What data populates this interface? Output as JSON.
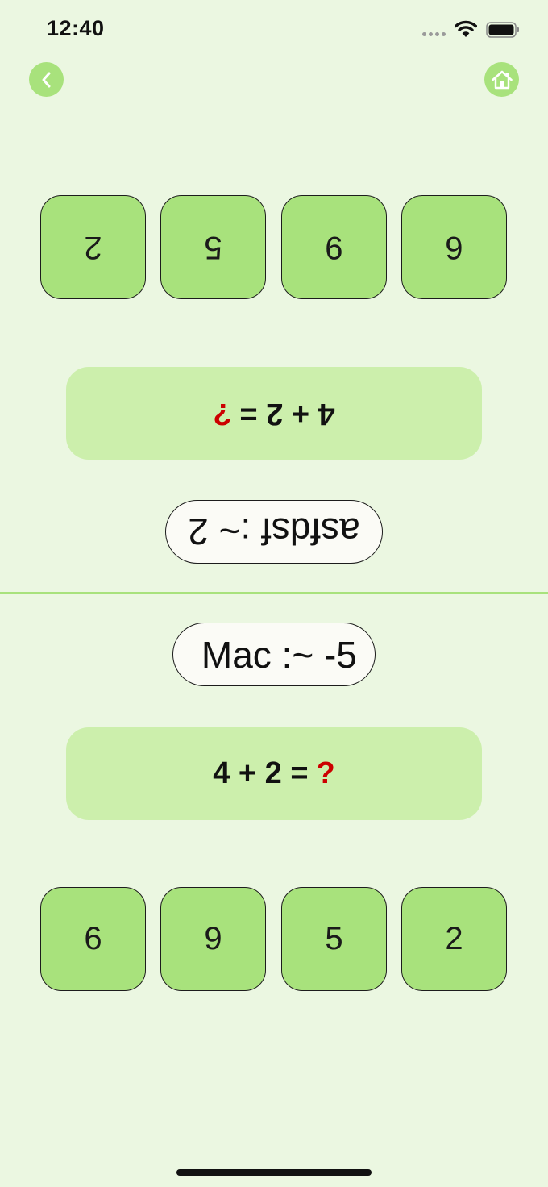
{
  "status_bar": {
    "time": "12:40",
    "icons": [
      "signal-dots-icon",
      "wifi-icon",
      "battery-icon"
    ]
  },
  "nav": {
    "back_icon": "chevron-left-icon",
    "home_icon": "house-icon",
    "accent_color": "#a8e27c"
  },
  "top_player": {
    "orientation": "upside-down",
    "options": [
      "6",
      "9",
      "5",
      "2"
    ],
    "question": {
      "expression": "4 + 2 =",
      "unknown": "?"
    },
    "score_label": "asfdsf :~ 2"
  },
  "bottom_player": {
    "orientation": "upright",
    "options": [
      "6",
      "9",
      "5",
      "2"
    ],
    "question": {
      "expression": "4 + 2 =",
      "unknown": "?"
    },
    "score_label": " Mac :~ -5"
  },
  "colors": {
    "background": "#ebf7e1",
    "tile": "#a8e27c",
    "question_box": "#ccefac",
    "unknown_mark": "#cc0000"
  }
}
